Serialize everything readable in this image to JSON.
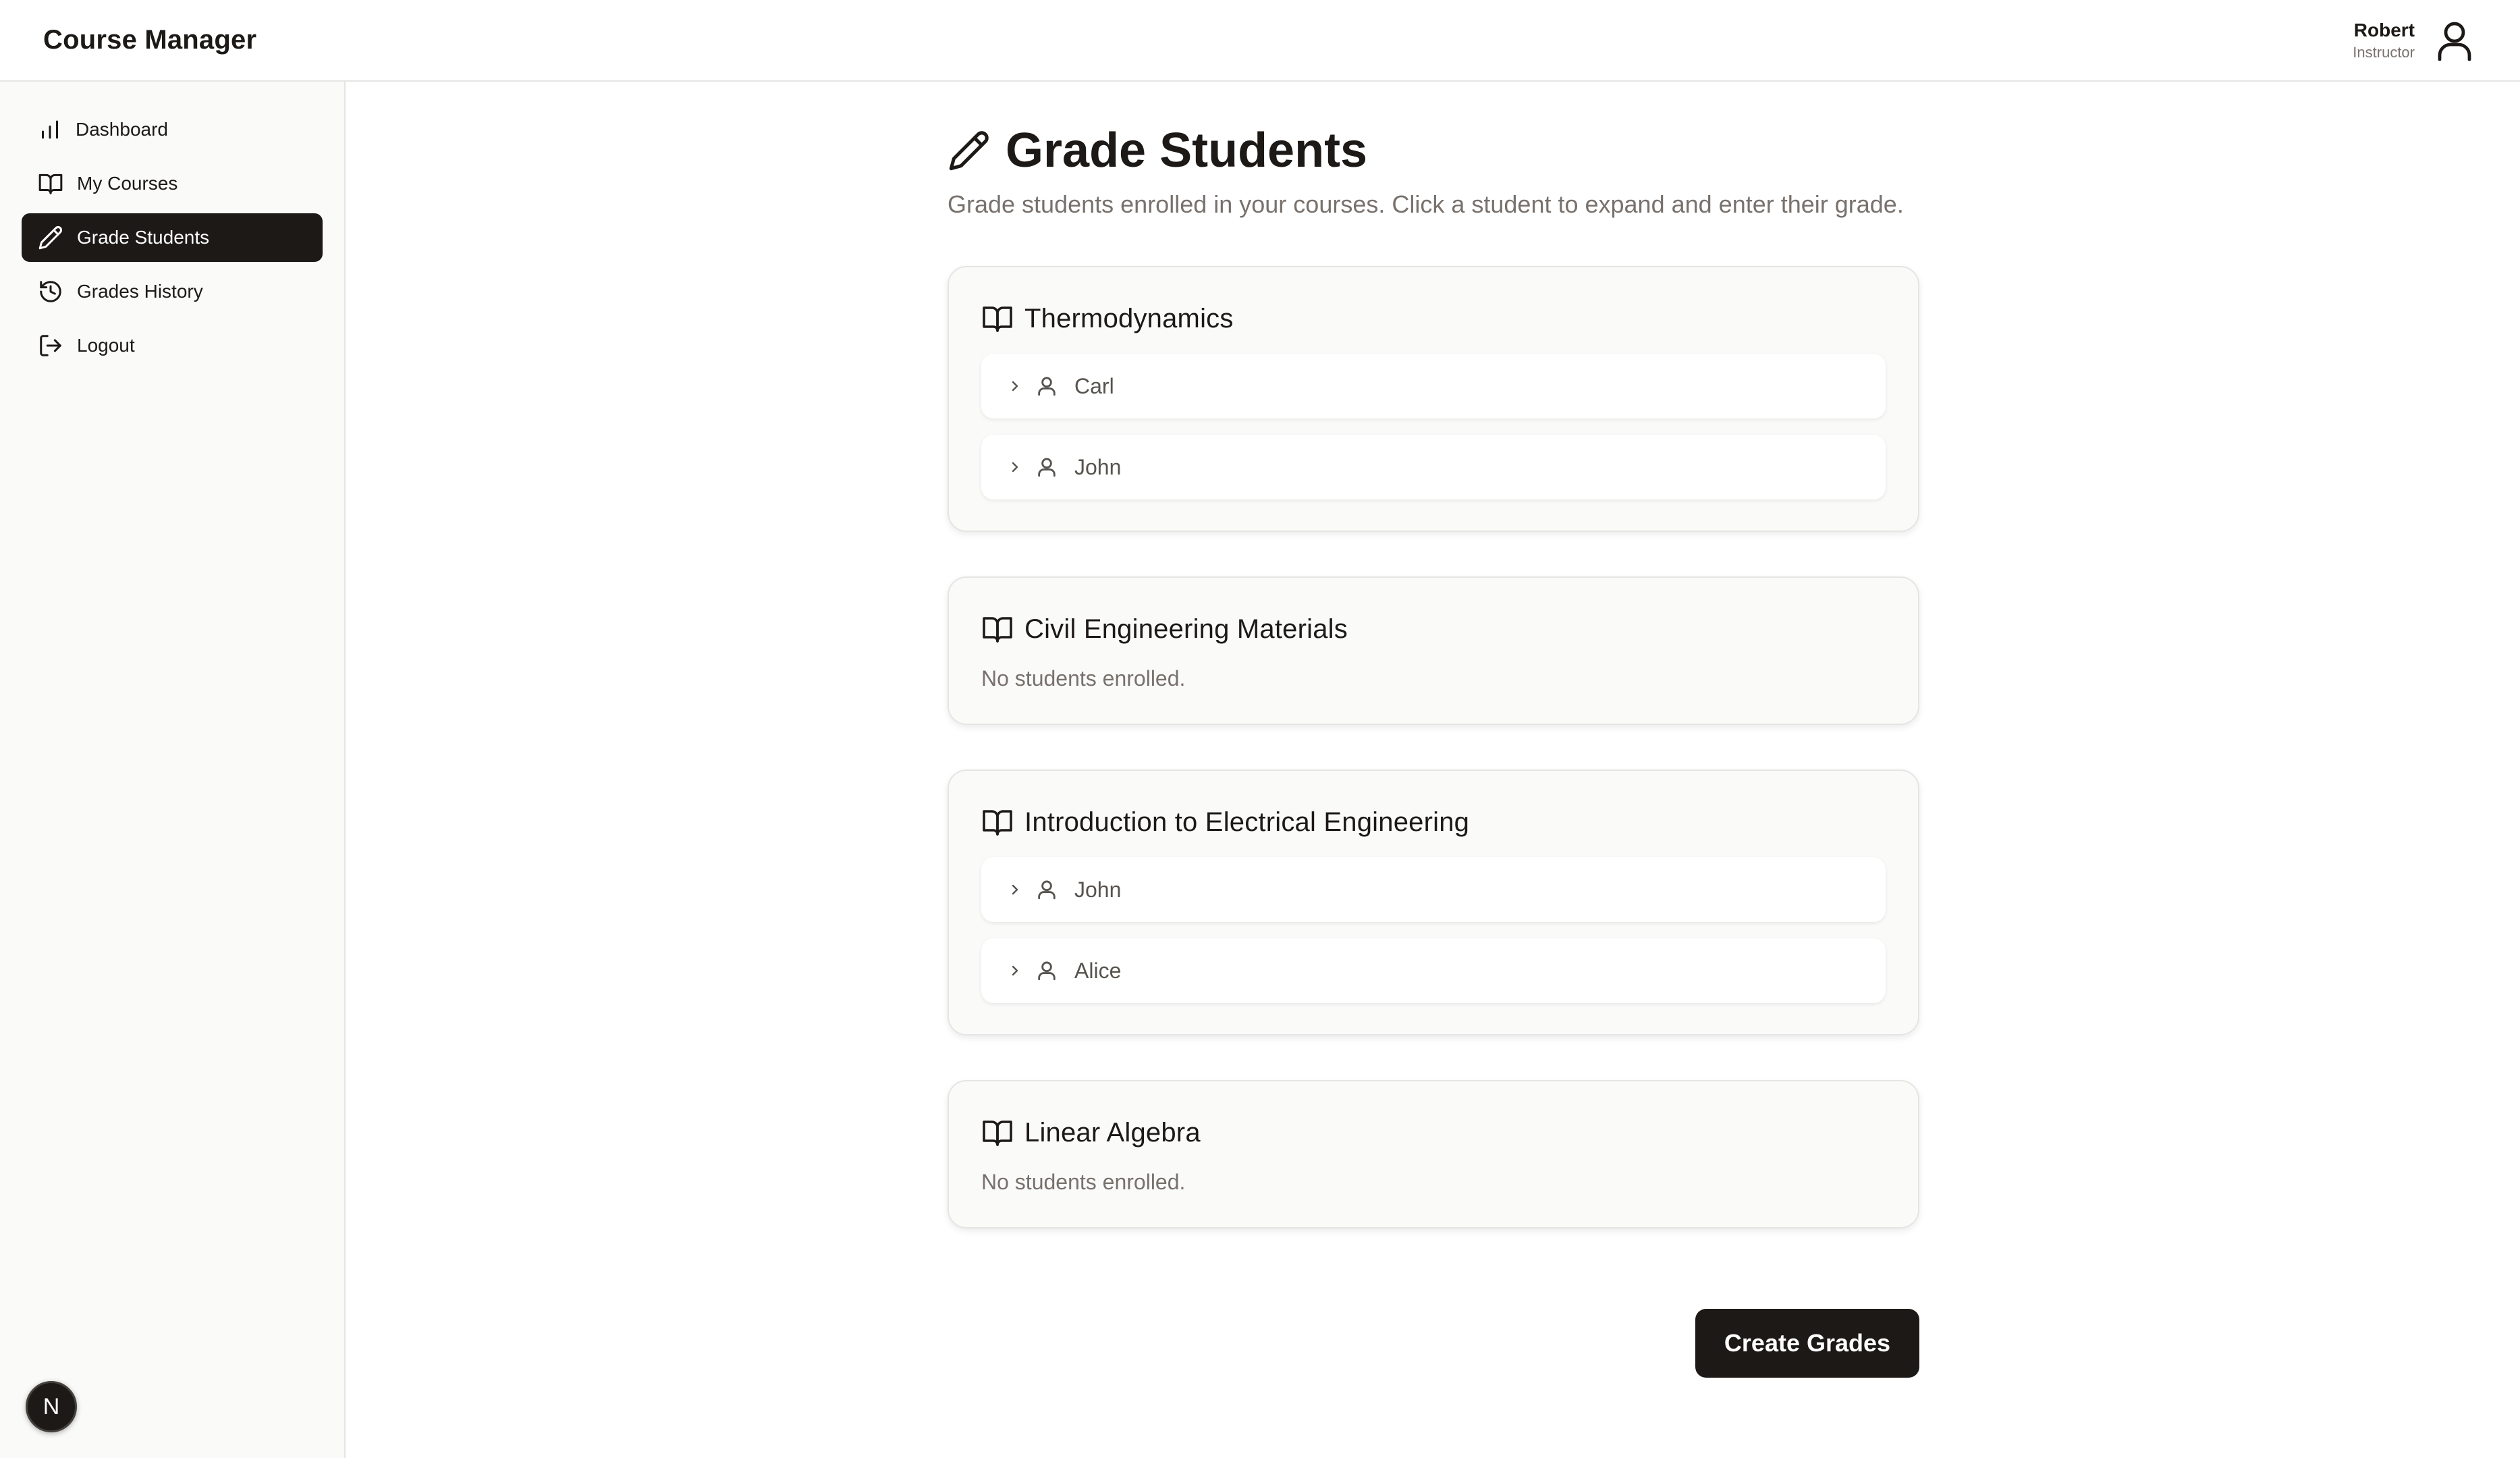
{
  "app": {
    "title": "Course Manager"
  },
  "user": {
    "name": "Robert",
    "role": "Instructor",
    "avatar_icon": "user-icon"
  },
  "sidebar": {
    "items": [
      {
        "label": "Dashboard",
        "icon": "bar-chart-icon",
        "active": false
      },
      {
        "label": "My Courses",
        "icon": "book-open-icon",
        "active": false
      },
      {
        "label": "Grade Students",
        "icon": "pencil-icon",
        "active": true
      },
      {
        "label": "Grades History",
        "icon": "history-icon",
        "active": false
      },
      {
        "label": "Logout",
        "icon": "logout-icon",
        "active": false
      }
    ],
    "badge": "N"
  },
  "main": {
    "title": "Grade Students",
    "subtitle": "Grade students enrolled in your courses. Click a student to expand and enter their grade.",
    "courses": [
      {
        "title": "Thermodynamics",
        "students": [
          "Carl",
          "John"
        ],
        "empty_text": ""
      },
      {
        "title": "Civil Engineering Materials",
        "students": [],
        "empty_text": "No students enrolled."
      },
      {
        "title": "Introduction to Electrical Engineering",
        "students": [
          "John",
          "Alice"
        ],
        "empty_text": ""
      },
      {
        "title": "Linear Algebra",
        "students": [],
        "empty_text": "No students enrolled."
      }
    ],
    "create_button_label": "Create Grades"
  },
  "colors": {
    "primary": "#1c1917",
    "muted_text": "#78716c",
    "card_bg": "#fafaf9",
    "border": "#e7e5e4"
  }
}
